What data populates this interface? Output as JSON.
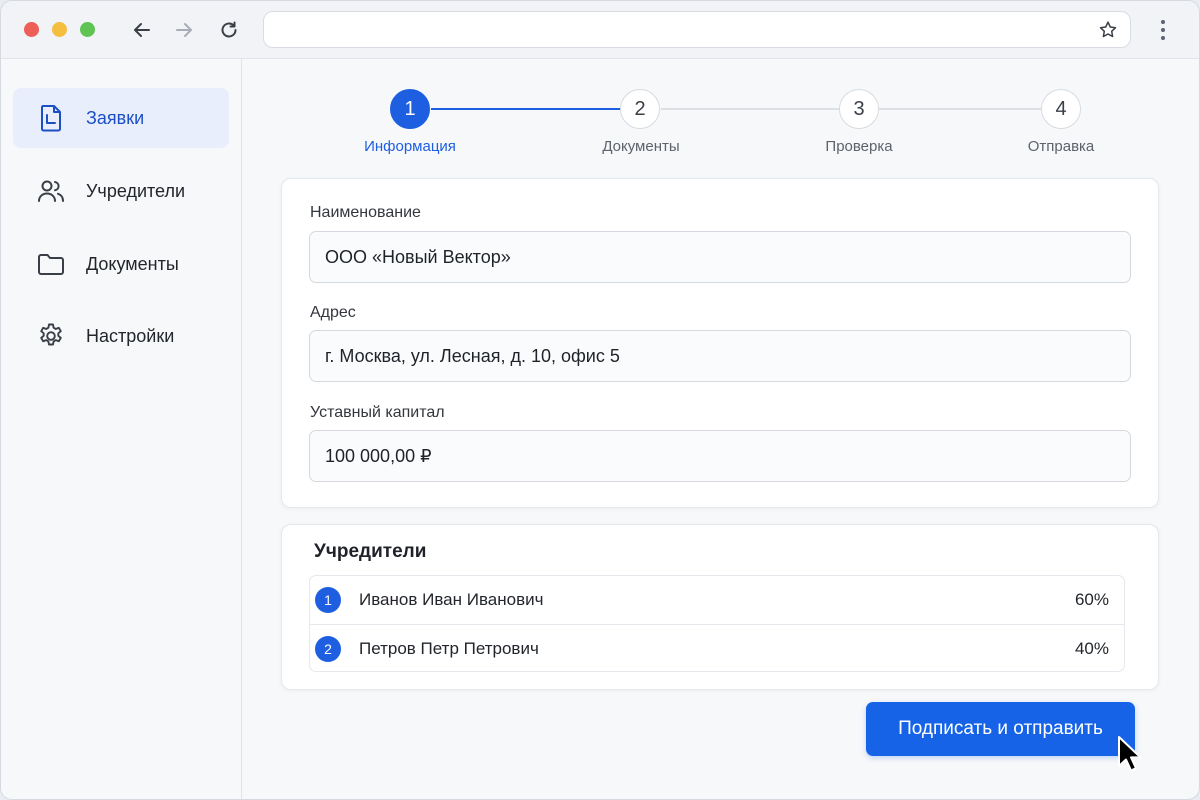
{
  "browser": {
    "address": "",
    "icons": [
      "back-arrow-icon",
      "forward-arrow-icon",
      "reload-icon",
      "star-icon",
      "kebab-menu-icon"
    ]
  },
  "sidebar": {
    "items": [
      {
        "label": "Заявки",
        "icon": "document-icon",
        "active": true
      },
      {
        "label": "Учредители",
        "icon": "users-icon",
        "active": false
      },
      {
        "label": "Документы",
        "icon": "folder-icon",
        "active": false
      },
      {
        "label": "Настройки",
        "icon": "gear-icon",
        "active": false
      }
    ]
  },
  "stepper": {
    "steps": [
      {
        "number": "1",
        "label": "Информация",
        "active": true
      },
      {
        "number": "2",
        "label": "Документы",
        "active": false
      },
      {
        "number": "3",
        "label": "Проверка",
        "active": false
      },
      {
        "number": "4",
        "label": "Отправка",
        "active": false
      }
    ]
  },
  "form": {
    "name_label": "Наименование",
    "name_value": "ООО «Новый Вектор»",
    "address_label": "Адрес",
    "address_value": "г. Москва, ул. Лесная, д. 10, офис 5",
    "capital_label": "Уставный капитал",
    "capital_value": "100 000,00 ₽"
  },
  "founders": {
    "title": "Учредители",
    "rows": [
      {
        "number": "1",
        "name": "Иванов Иван Иванович",
        "share": "60%"
      },
      {
        "number": "2",
        "name": "Петров Петр Петрович",
        "share": "40%"
      }
    ]
  },
  "actions": {
    "submit_label": "Подписать и отправить"
  },
  "colors": {
    "accent": "#1d5fe0",
    "button": "#1663e8",
    "active_sidebar_bg": "#e8eefb"
  }
}
